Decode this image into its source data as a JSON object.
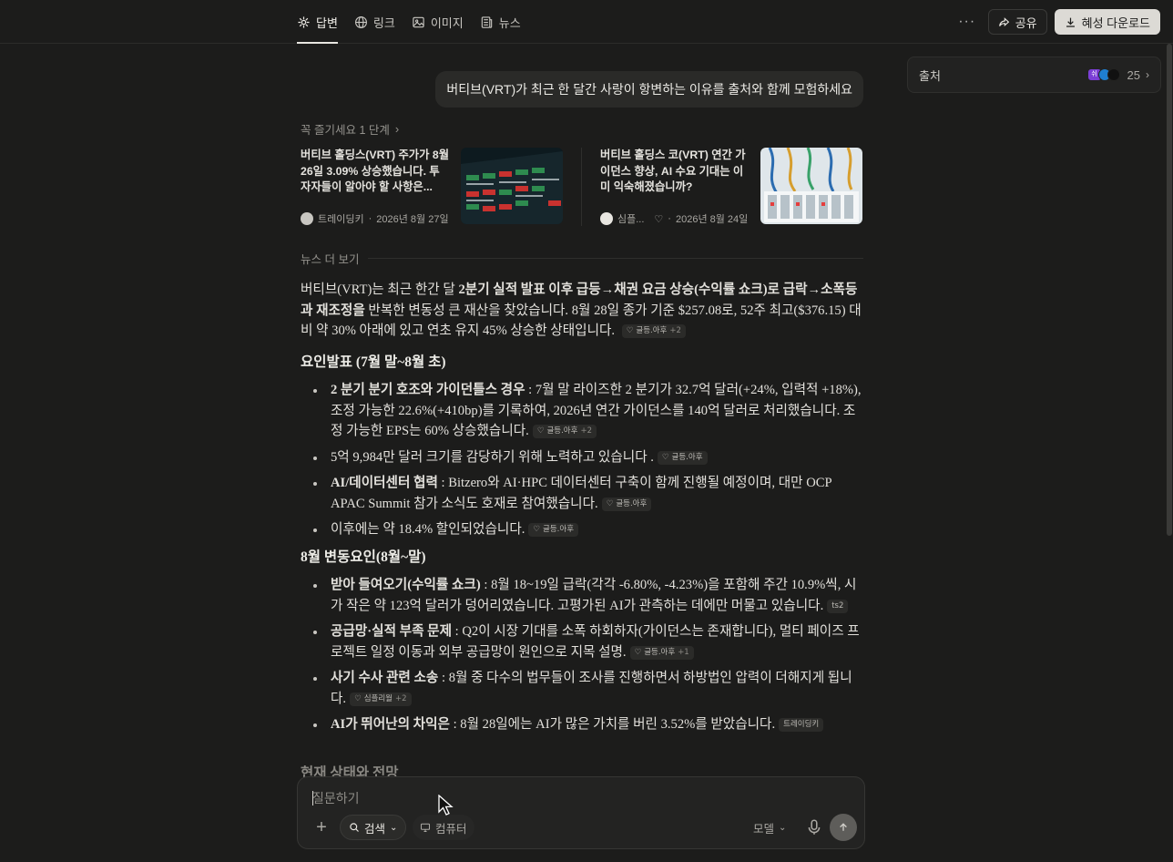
{
  "tabs": [
    {
      "label": "답변",
      "icon": "sparkle-icon",
      "active": true
    },
    {
      "label": "링크",
      "icon": "globe-icon",
      "active": false
    },
    {
      "label": "이미지",
      "icon": "image-icon",
      "active": false
    },
    {
      "label": "뉴스",
      "icon": "newspaper-icon",
      "active": false
    }
  ],
  "toolbar": {
    "more_label": "···",
    "share_label": "공유",
    "download_label": "혜성 다운로드"
  },
  "sources": {
    "label": "출처",
    "count": "25",
    "avatar_label": "쉬"
  },
  "query": "버티브(VRT)가 최근 한 달간 사랑이 항변하는 이유를 출처와 함께 모험하세요",
  "steps_label": "꼭 즐기세요 1 단계",
  "news": [
    {
      "title": "버티브 홀딩스(VRT) 주가가 8월 26일 3.09% 상승했습니다. 투자자들이 알아야 할 사항은...",
      "source": "트레이딩키",
      "date": "2026년 8월 27일",
      "separator": "·"
    },
    {
      "title": "버티브 홀딩스 코(VRT) 연간 가이던스 향상, AI 수요 기대는 이미 익숙해졌습니까?",
      "source": "심플...",
      "date": "2026년 8월 24일",
      "separator": "·"
    }
  ],
  "more_news_label": "뉴스 더 보기",
  "answer": {
    "intro_pre": "버티브(VRT)는 최근 한간 달 ",
    "intro_bold": "2분기 실적 발표 이후 급등→채권 요금 상승(수익률 쇼크)로 급락→소폭등과 재조정을",
    "intro_post": " 반복한 변동성 큰 재산을 찾았습니다. 8월 28일 종가 기준 $257.08로, 52주 최고($376.15) 대비 약 30% 아래에 있고 연초 유지 45% 상승한 상태입니다.",
    "intro_cite": "글등.아후",
    "intro_cite_more": "+2",
    "h1": "요인발표 (7월 말~8월 초)",
    "b1_bold": "2 분기 분기 호조와 가이던틀스 경우",
    "b1_text": " : 7월 말 라이즈한 2 분기가 32.7억 달러(+24%, 입력적 +18%), 조정 가능한 22.6%(+410bp)를 기록하여, 2026년 연간 가이던스를 140억 달러로 처리했습니다. 조정 가능한 EPS는 60% 상승했습니다.",
    "b1_cite": "글등.아후",
    "b1_cite_more": "+2",
    "b2_text": "5억 9,984만 달러 크기를 감당하기 위해 노력하고 있습니다 .",
    "b2_cite": "글등.아후",
    "b3_bold": "AI/데이터센터 협력",
    "b3_text": " : Bitzero와 AI·HPC 데이터센터 구축이 함께 진행될 예정이며, 대만 OCP APAC Summit 참가 소식도 호재로 참여했습니다.",
    "b3_cite": "글등.아후",
    "b4_text": "이후에는 약 18.4% 할인되었습니다.",
    "b4_cite": "글등.아후",
    "h2": "8월 변동요인(8월~말)",
    "c1_bold": "받아 들여오기(수익률 쇼크)",
    "c1_text": " : 8월 18~19일 급락(각각 -6.80%, -4.23%)을 포함해 주간 10.9%씩, 시가 작은 약 123억 달러가 덩어리였습니다. 고평가된 AI가 관측하는 데에만 머물고 있습니다.",
    "c1_cite": "ts2",
    "c2_bold": "공급망·실적 부족 문제",
    "c2_text": " : Q2이 시장 기대를 소폭 하회하자(가이던스는 존재합니다), 멀티 페이즈 프로젝트 일정 이동과 외부 공급망이 원인으로 지목 설명.",
    "c2_cite": "글등.아후",
    "c2_cite_more": "+1",
    "c3_bold": "사기 수사 관련 소송",
    "c3_text": " : 8월 중 다수의 법무들이 조사를 진행하면서 하방법인 압력이 더해지게 됩니다.",
    "c3_cite": "심플리월",
    "c3_cite_more": "+2",
    "c4_bold": "AI가 뛰어난의 차익은",
    "c4_text": " : 8월 28일에는 AI가 많은 가치를 버린 3.52%를 받았습니다.",
    "c4_cite": "트레이딩키",
    "h3": "현재 상태와 전망"
  },
  "composer": {
    "placeholder": "질문하기",
    "plus_label": "+",
    "search_label": "검색",
    "computer_label": "컴퓨터",
    "model_label": "모델"
  },
  "colors": {
    "background": "#1c1c1b",
    "accent_button": "#dcdad5"
  }
}
